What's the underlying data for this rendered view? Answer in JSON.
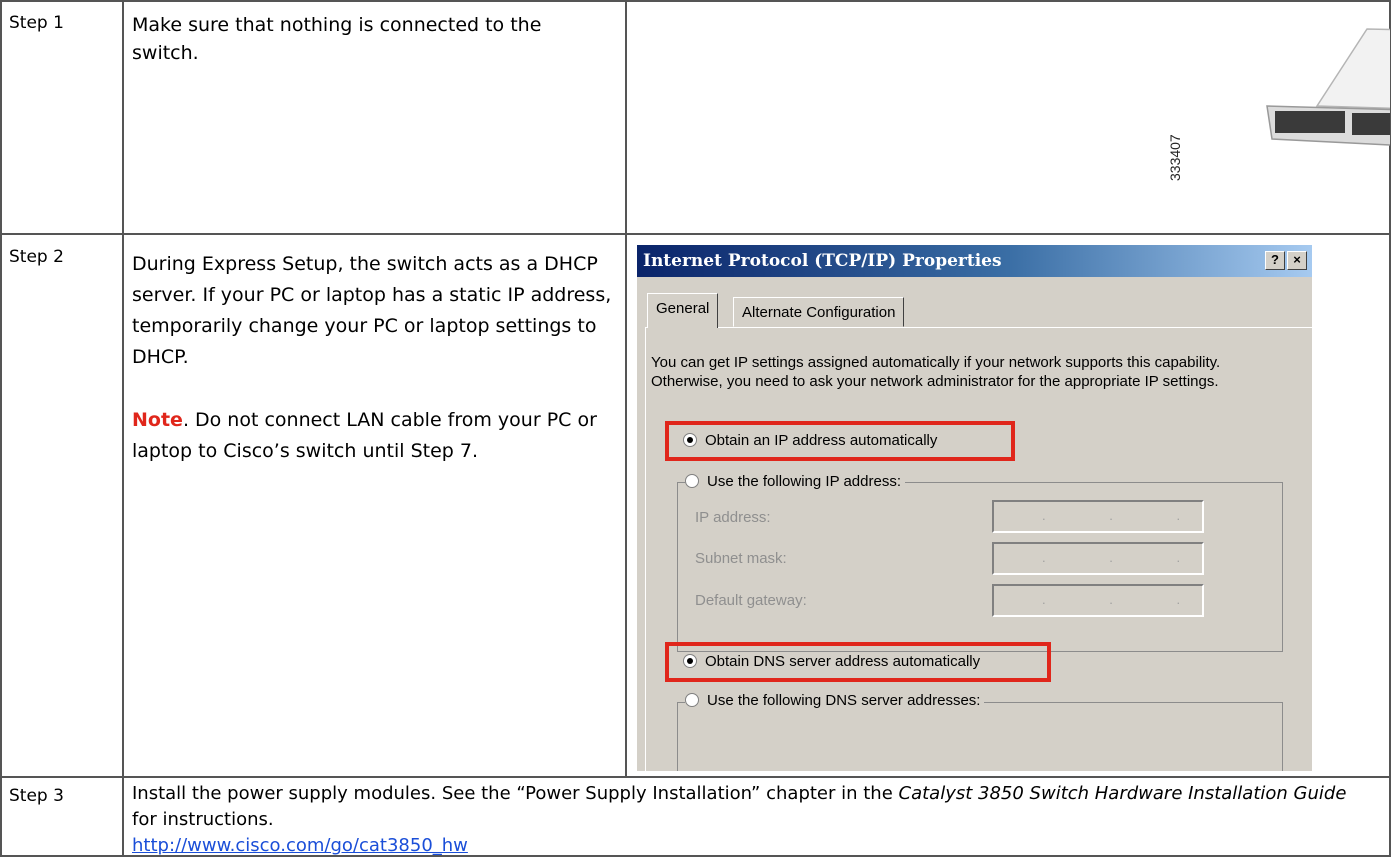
{
  "steps": [
    {
      "label": "Step 1",
      "text": "Make sure that nothing is connected to the switch.",
      "figure_number": "333407"
    },
    {
      "label": "Step 2",
      "text": "During Express Setup, the switch acts as a DHCP server. If your PC or laptop has a static IP address, temporarily change your PC or laptop settings to DHCP.",
      "note_label": "Note",
      "note_text": ". Do not connect LAN cable from your PC or laptop to Cisco’s switch until Step 7."
    },
    {
      "label": "Step 3",
      "text_before": "Install the power supply modules. See the “Power Supply Installation” chapter in the ",
      "italic_title": "Catalyst 3850 Switch Hardware Installation Guide",
      "text_after": " for instructions.",
      "link": "http://www.cisco.com/go/cat3850_hw"
    }
  ],
  "dialog": {
    "title": "Internet Protocol (TCP/IP) Properties",
    "help_button": "?",
    "close_button": "×",
    "tabs": [
      "General",
      "Alternate Configuration"
    ],
    "intro": "You can get IP settings assigned automatically if your network supports this capability. Otherwise, you need to ask your network administrator for the appropriate IP settings.",
    "radio_ip_auto": "Obtain an IP address automatically",
    "radio_ip_manual": "Use the following IP address:",
    "fields": [
      "IP address:",
      "Subnet mask:",
      "Default gateway:"
    ],
    "ip_placeholder": ". . .",
    "radio_dns_auto": "Obtain DNS server address automatically",
    "radio_dns_manual": "Use the following DNS server addresses:"
  },
  "colors": {
    "note": "#e0261b",
    "highlight": "#e0261b",
    "link": "#1a4ed8",
    "titlebar": "#0a246a"
  }
}
